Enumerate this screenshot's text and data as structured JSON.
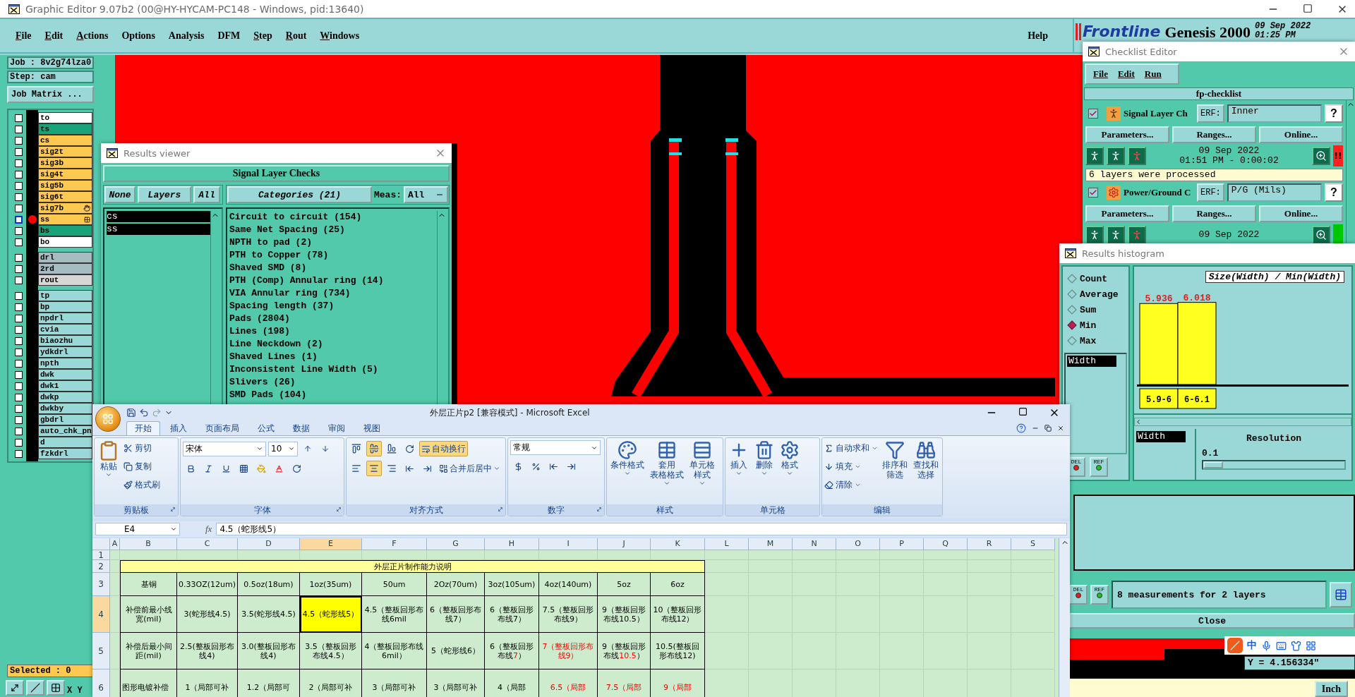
{
  "app": {
    "title": "Graphic Editor 9.07b2 (00@HY-HYCAM-PC148 - Windows, pid:13640)",
    "menu": [
      {
        "label": "File",
        "mnemonic": true
      },
      {
        "label": "Edit",
        "mnemonic": true
      },
      {
        "label": "Actions",
        "mnemonic": true
      },
      {
        "label": "Options",
        "mnemonic": false
      },
      {
        "label": "Analysis",
        "mnemonic": false
      },
      {
        "label": "DFM",
        "mnemonic": false
      },
      {
        "label": "Step",
        "mnemonic": true
      },
      {
        "label": "Rout",
        "mnemonic": true
      },
      {
        "label": "Windows",
        "mnemonic": true
      }
    ],
    "help": "Help",
    "brand": {
      "logo": "Frontline",
      "product": "Genesis 2000",
      "date": "09 Sep 2022",
      "time": "01:25 PM"
    }
  },
  "job_panel": {
    "job": "Job : 8v2g74lza0",
    "step": "Step: cam",
    "matrix_button": "Job Matrix ...",
    "layer_groups": [
      {
        "layers": [
          {
            "name": "to",
            "color": "#ffffff",
            "checked": false,
            "work": false,
            "kind": "plain"
          },
          {
            "name": "ts",
            "color": "#1aa37a",
            "checked": false,
            "work": false,
            "kind": "plain"
          },
          {
            "name": "cs",
            "color": "#ffc850",
            "checked": false,
            "work": false,
            "kind": "plain"
          },
          {
            "name": "sig2t",
            "color": "#ffc850",
            "checked": false,
            "work": false,
            "kind": "plain"
          },
          {
            "name": "sig3b",
            "color": "#ffc850",
            "checked": false,
            "work": false,
            "kind": "plain"
          },
          {
            "name": "sig4t",
            "color": "#ffc850",
            "checked": false,
            "work": false,
            "kind": "plain"
          },
          {
            "name": "sig5b",
            "color": "#ffc850",
            "checked": false,
            "work": false,
            "kind": "plain"
          },
          {
            "name": "sig6t",
            "color": "#ffc850",
            "checked": false,
            "work": false,
            "kind": "plain"
          },
          {
            "name": "sig7b",
            "color": "#ffc850",
            "checked": false,
            "work": false,
            "kind": "hand"
          },
          {
            "name": "ss",
            "color": "#ffc850",
            "checked": false,
            "work": true,
            "kind": "grid"
          },
          {
            "name": "bs",
            "color": "#1aa37a",
            "checked": false,
            "work": false,
            "kind": "plain"
          },
          {
            "name": "bo",
            "color": "#ffffff",
            "checked": false,
            "work": false,
            "kind": "plain"
          }
        ]
      },
      {
        "layers": [
          {
            "name": "drl",
            "color": "#a6bcc0",
            "checked": false,
            "work": false,
            "kind": "plain"
          },
          {
            "name": "2rd",
            "color": "#a6bcc0",
            "checked": false,
            "work": false,
            "kind": "plain"
          },
          {
            "name": "rout",
            "color": "#d6d6d6",
            "checked": false,
            "work": false,
            "kind": "plain"
          }
        ]
      },
      {
        "layers": [
          {
            "name": "tp",
            "color": "#9ad8d8",
            "checked": false,
            "work": false,
            "kind": "plain"
          },
          {
            "name": "bp",
            "color": "#9ad8d8",
            "checked": false,
            "work": false,
            "kind": "plain"
          },
          {
            "name": "npdrl",
            "color": "#9ad8d8",
            "checked": false,
            "work": false,
            "kind": "plain"
          },
          {
            "name": "cvia",
            "color": "#9ad8d8",
            "checked": false,
            "work": false,
            "kind": "plain"
          },
          {
            "name": "biaozhu",
            "color": "#9ad8d8",
            "checked": false,
            "work": false,
            "kind": "plain"
          },
          {
            "name": "ydkdrl",
            "color": "#9ad8d8",
            "checked": false,
            "work": false,
            "kind": "plain"
          },
          {
            "name": "npth",
            "color": "#9ad8d8",
            "checked": false,
            "work": false,
            "kind": "plain"
          },
          {
            "name": "dwk",
            "color": "#9ad8d8",
            "checked": false,
            "work": false,
            "kind": "plain"
          },
          {
            "name": "dwk1",
            "color": "#9ad8d8",
            "checked": false,
            "work": false,
            "kind": "plain"
          },
          {
            "name": "dwkp",
            "color": "#9ad8d8",
            "checked": false,
            "work": false,
            "kind": "plain"
          },
          {
            "name": "dwkby",
            "color": "#9ad8d8",
            "checked": false,
            "work": false,
            "kind": "plain"
          },
          {
            "name": "gbdrl",
            "color": "#9ad8d8",
            "checked": false,
            "work": false,
            "kind": "plain"
          },
          {
            "name": "auto_chk_pn",
            "color": "#9ad8d8",
            "checked": false,
            "work": false,
            "kind": "plain"
          },
          {
            "name": "d",
            "color": "#9ad8d8",
            "checked": false,
            "work": false,
            "kind": "plain"
          },
          {
            "name": "fzkdrl",
            "color": "#9ad8d8",
            "checked": false,
            "work": false,
            "kind": "plain"
          }
        ]
      }
    ],
    "selected_count": "Selected : 0",
    "coordinates_label": "X Y"
  },
  "results_viewer": {
    "title": "Results viewer",
    "heading": "Signal Layer Checks",
    "none_button": "None",
    "layers_button": "Layers",
    "all_button": "All",
    "layers": [
      {
        "name": "cs",
        "selected": true
      },
      {
        "name": "ss",
        "selected": true
      }
    ],
    "categories_button": "Categories (21)",
    "meas_label": "Meas:",
    "meas_value": "All",
    "categories": [
      "Circuit to circuit (154)",
      "Same Net Spacing (25)",
      "NPTH to pad (2)",
      "PTH to Copper (78)",
      "Shaved SMD (8)",
      "PTH (Comp) Annular ring (14)",
      "VIA Annular ring (734)",
      "Spacing length (37)",
      "Pads (2804)",
      "Lines (198)",
      "Line Neckdown (2)",
      "Shaved Lines (1)",
      "Inconsistent Line Width (5)",
      "Slivers (26)",
      "SMD Pads (104)"
    ]
  },
  "checklist_editor": {
    "title": "Checklist Editor",
    "menu": [
      "File",
      "Edit",
      "Run"
    ],
    "checklist": "fp-checklist",
    "actions": [
      {
        "checked": true,
        "kind": "signal",
        "name": "Signal Layer Ch",
        "erf_label": "ERF:",
        "erf": "Inner",
        "help": "?",
        "buttons": [
          "Parameters...",
          "Ranges...",
          "Online..."
        ],
        "date": "09 Sep 2022",
        "time": "01:51 PM - 0:00:02",
        "color": "#ff2020",
        "status_text": "!!",
        "message": "6 layers were processed"
      },
      {
        "checked": true,
        "kind": "power",
        "name": "Power/Ground C",
        "erf_label": "ERF:",
        "erf": "P/G (Mils)",
        "help": "?",
        "buttons": [
          "Parameters...",
          "Ranges...",
          "Online..."
        ],
        "date": "09 Sep 2022",
        "color": "#00c800"
      }
    ]
  },
  "histogram": {
    "title": "Results histogram",
    "modes": [
      {
        "label": "Count",
        "selected": false
      },
      {
        "label": "Average",
        "selected": false
      },
      {
        "label": "Sum",
        "selected": false
      },
      {
        "label": "Min",
        "selected": true
      },
      {
        "label": "Max",
        "selected": false
      }
    ],
    "attributes": [
      {
        "name": "Width",
        "selected": true
      }
    ],
    "list_buttons": [
      "DEL",
      "REF"
    ],
    "chart_title": "Size(Width) / Min(Width)",
    "chart_data": {
      "type": "bar",
      "categories": [
        "5.9-6",
        "6-6.1"
      ],
      "values": [
        5.936,
        6.018
      ],
      "data_labels": true
    },
    "resolution_attributes": [
      {
        "name": "Width",
        "selected": true
      }
    ],
    "resolution_label": "Resolution",
    "resolution_value": "0.1",
    "resolution_slider": {
      "level": 0
    },
    "footer_buttons": [
      "DEL",
      "REF"
    ],
    "message": "8 measurements for 2 layers",
    "close": "Close"
  },
  "excel": {
    "title": "外层正片p2  [兼容模式] - Microsoft Excel",
    "tabs": [
      {
        "label": "开始",
        "selected": true
      },
      {
        "label": "插入",
        "selected": false
      },
      {
        "label": "页面布局",
        "selected": false
      },
      {
        "label": "公式",
        "selected": false
      },
      {
        "label": "数据",
        "selected": false
      },
      {
        "label": "审阅",
        "selected": false
      },
      {
        "label": "视图",
        "selected": false
      }
    ],
    "ribbon": {
      "clipboard": {
        "label": "剪贴板",
        "paste": "粘贴",
        "items": [
          "剪切",
          "复制",
          "格式刷"
        ]
      },
      "font": {
        "label": "字体",
        "face": "宋体",
        "size": "10"
      },
      "alignment": {
        "label": "对齐方式",
        "wrap": {
          "label": "自动换行",
          "on": true
        },
        "merge": "合并后居中",
        "v_align": [
          {
            "kind": "top",
            "selected": false
          },
          {
            "kind": "middle",
            "selected": true
          },
          {
            "kind": "bottom",
            "selected": false
          }
        ],
        "h_align": [
          {
            "kind": "left",
            "selected": false
          },
          {
            "kind": "center",
            "selected": true
          },
          {
            "kind": "right",
            "selected": false
          }
        ]
      },
      "number": {
        "label": "数字",
        "format": "常规"
      },
      "styles": {
        "label": "样式",
        "buttons": [
          {
            "lines": [
              "条件格式"
            ]
          },
          {
            "lines": [
              "套用",
              "表格格式"
            ]
          },
          {
            "lines": [
              "单元格",
              "样式"
            ]
          }
        ]
      },
      "cells": {
        "label": "单元格",
        "buttons": [
          "插入",
          "删除",
          "格式"
        ]
      },
      "editing": {
        "label": "编辑",
        "items": [
          "自动求和",
          "填充",
          "清除"
        ],
        "buttons": [
          {
            "lines": [
              "排序和",
              "筛选"
            ]
          },
          {
            "lines": [
              "查找和",
              "选择"
            ]
          }
        ]
      }
    },
    "name_box": "E4",
    "function_label": "fx",
    "formula": "4.5（蛇形线5）",
    "columns": [
      {
        "letter": "A",
        "selected": false
      },
      {
        "letter": "B",
        "selected": false
      },
      {
        "letter": "C",
        "selected": false
      },
      {
        "letter": "D",
        "selected": false
      },
      {
        "letter": "E",
        "selected": true
      },
      {
        "letter": "F",
        "selected": false
      },
      {
        "letter": "G",
        "selected": false
      },
      {
        "letter": "H",
        "selected": false
      },
      {
        "letter": "I",
        "selected": false
      },
      {
        "letter": "J",
        "selected": false
      },
      {
        "letter": "K",
        "selected": false
      },
      {
        "letter": "L",
        "selected": false
      },
      {
        "letter": "M",
        "selected": false
      },
      {
        "letter": "N",
        "selected": false
      },
      {
        "letter": "O",
        "selected": false
      },
      {
        "letter": "P",
        "selected": false
      },
      {
        "letter": "Q",
        "selected": false
      },
      {
        "letter": "R",
        "selected": false
      },
      {
        "letter": "S",
        "selected": false
      }
    ],
    "rows": [
      {
        "number": "1",
        "kind": "blank",
        "selected": false
      },
      {
        "number": "2",
        "kind": "title",
        "selected": false,
        "text": "外层正片制作能力说明"
      },
      {
        "number": "3",
        "kind": "header",
        "selected": false,
        "cells": [
          {
            "text": "基铜",
            "red": false,
            "selected": false
          },
          {
            "text": "0.33OZ(12um)",
            "red": false,
            "selected": false
          },
          {
            "text": "0.5oz(18um)",
            "red": false,
            "selected": false
          },
          {
            "text": "1oz(35um)",
            "red": false,
            "selected": false
          },
          {
            "text": "50um",
            "red": false,
            "selected": false
          },
          {
            "text": "2Oz(70um)",
            "red": false,
            "selected": false
          },
          {
            "text": "3oz(105um)",
            "red": false,
            "selected": false
          },
          {
            "text": "4oz(140um)",
            "red": false,
            "selected": false
          },
          {
            "text": "5oz",
            "red": false,
            "selected": false
          },
          {
            "text": "6oz",
            "red": false,
            "selected": false
          }
        ]
      },
      {
        "number": "4",
        "kind": "data",
        "selected": true,
        "cells": [
          {
            "text": "补偿前最小线宽(mil)",
            "red": false,
            "selected": false
          },
          {
            "text": "3(蛇形线4.5)",
            "red": false,
            "selected": false
          },
          {
            "text": "3.5(蛇形线4.5)",
            "red": false,
            "selected": false
          },
          {
            "text": "4.5（蛇形线5）",
            "red": false,
            "selected": true
          },
          {
            "text": "4.5（整板回形布线6mil",
            "red": false,
            "selected": false
          },
          {
            "text": "6（整板回形布线7）",
            "red": false,
            "selected": false
          },
          {
            "text": "6（整板回形布线7）",
            "red": false,
            "selected": false
          },
          {
            "text": "7.5（整板回形布线9）",
            "red": false,
            "selected": false
          },
          {
            "text": "9（整板回形布线10.5）",
            "red": false,
            "selected": false
          },
          {
            "text": "10（整板回形布线12）",
            "red": false,
            "selected": false
          }
        ]
      },
      {
        "number": "5",
        "kind": "data",
        "selected": false,
        "cells": [
          {
            "text": "补偿后最小间距(mil)",
            "red": false,
            "selected": false
          },
          {
            "text": "2.5(整板回形布线4)",
            "red": false,
            "selected": false
          },
          {
            "text": "3.0(整板回形布线4)",
            "red": false,
            "selected": false
          },
          {
            "text": "3.5（整板回形布线4.5）",
            "red": false,
            "selected": false
          },
          {
            "text": "4（整板回形布线6mil）",
            "red": false,
            "selected": false
          },
          {
            "text": "5（蛇形线6）",
            "red": false,
            "selected": false
          },
          {
            "runs": [
              {
                "text": "6（整板回形布线",
                "red": false
              },
              {
                "text": "7",
                "red": true
              },
              {
                "text": "）",
                "red": false
              }
            ],
            "selected": false
          },
          {
            "text": "7（整板回形布线9）",
            "red": true,
            "selected": false
          },
          {
            "runs": [
              {
                "text": "9（整板回形布线",
                "red": false
              },
              {
                "text": "10.5",
                "red": true
              },
              {
                "text": "）",
                "red": false
              }
            ],
            "selected": false
          },
          {
            "text": "10.5(整板回形布线12)",
            "red": false,
            "selected": false
          }
        ]
      },
      {
        "number": "6",
        "kind": "data",
        "selected": false,
        "cells": [
          {
            "text": "图形电镀补偿",
            "red": false,
            "selected": false
          },
          {
            "text": "1（局部可补",
            "red": false,
            "selected": false
          },
          {
            "text": "1.2（局部可",
            "red": false,
            "selected": false
          },
          {
            "text": "2（局部可补",
            "red": false,
            "selected": false
          },
          {
            "text": "3（局部可补",
            "red": false,
            "selected": false
          },
          {
            "text": "3（局部可补",
            "red": false,
            "selected": false
          },
          {
            "text": "4（局部",
            "red": false,
            "selected": false
          },
          {
            "text": "6.5（局部",
            "red": true,
            "selected": false
          },
          {
            "text": "7.5（局部",
            "red": true,
            "selected": false
          },
          {
            "text": "9（局部",
            "red": true,
            "selected": false
          }
        ]
      }
    ]
  },
  "status": {
    "ime_mode": "中",
    "coordinate": "Y = 4.156334\"",
    "units": "Inch"
  }
}
